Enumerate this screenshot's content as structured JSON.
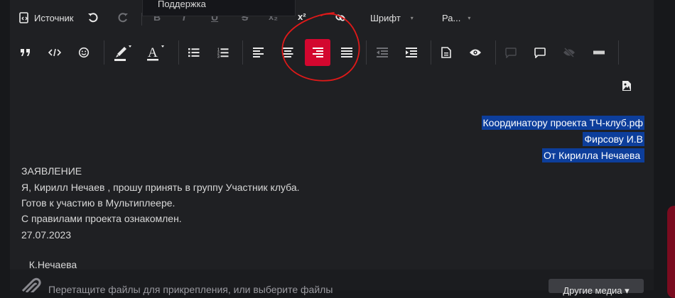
{
  "popup": {
    "item": "Поддержка"
  },
  "toolbar": {
    "source_label": "Источник",
    "font_label": "Шрифт",
    "size_label": "Ра...",
    "ghost_bold": "B",
    "ghost_italic": "I",
    "ghost_underline": "U",
    "ghost_strike": "S",
    "subscript_label": "x₂",
    "superscript_label": "x²",
    "active_color": "#d3072f",
    "annotation_color": "#e01919"
  },
  "content": {
    "right_aligned": [
      "Координатору проекта ТЧ-клуб.рф",
      "Фирсову И.В",
      "От Кирилла Нечаева "
    ],
    "body": [
      "ЗАЯВЛЕНИЕ",
      "Я, Кирилл Нечаев , прошу принять в группу Участник клуба.",
      "Готов к участию в Мультиплеере.",
      "С правилами проекта ознакомлен.",
      "27.07.2023"
    ],
    "signature": "К.Нечаева",
    "highlight_color": "#0d3e9b"
  },
  "dropzone": {
    "text": "Перетащите файлы для прикрепления, или выберите файлы",
    "media_button": "Другие медиа ▾"
  }
}
